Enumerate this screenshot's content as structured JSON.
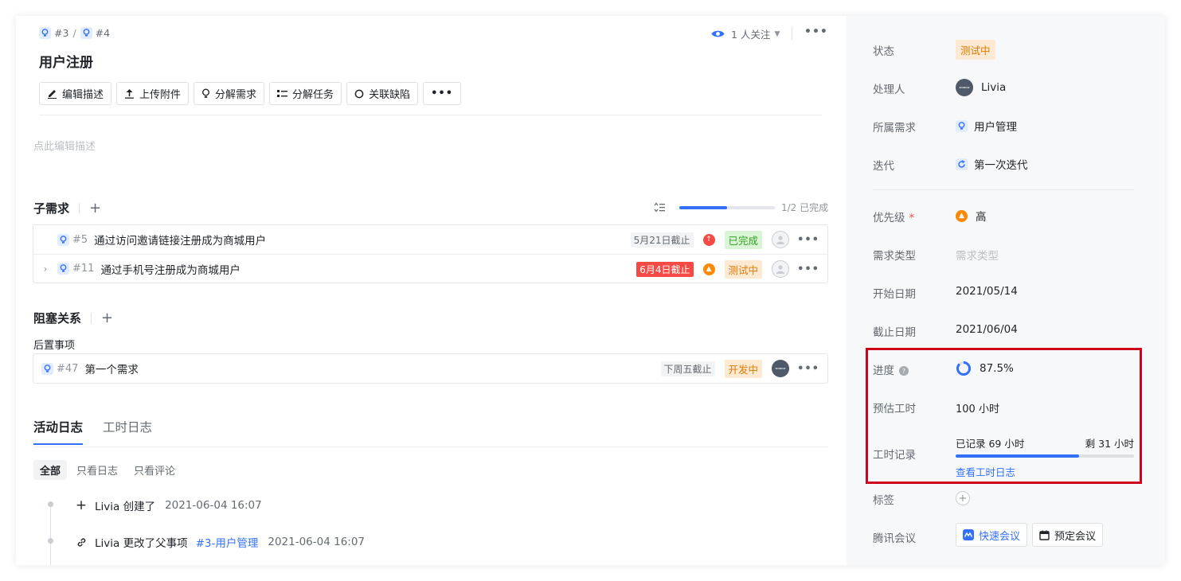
{
  "breadcrumb": {
    "parent": "#3",
    "sep": "/",
    "current": "#4"
  },
  "watch": {
    "label": "1 人关注"
  },
  "title": "用户注册",
  "toolbar": {
    "edit": "编辑描述",
    "upload": "上传附件",
    "split_req": "分解需求",
    "split_task": "分解任务",
    "link_bug": "关联缺陷"
  },
  "description_placeholder": "点此编辑描述",
  "subreq": {
    "title": "子需求",
    "progress_label": "1/2 已完成",
    "progress_fraction": 0.5,
    "items": [
      {
        "num": "#5",
        "name": "通过访问邀请链接注册成为商城用户",
        "due": "5月21日截止",
        "status": "已完成"
      },
      {
        "num": "#11",
        "name": "通过手机号注册成为商城用户",
        "due": "6月4日截止",
        "status": "测试中"
      }
    ]
  },
  "blocking": {
    "title": "阻塞关系",
    "subheading": "后置事项",
    "items": [
      {
        "num": "#47",
        "name": "第一个需求",
        "due": "下周五截止",
        "status": "开发中"
      }
    ]
  },
  "tabs": [
    "活动日志",
    "工时日志"
  ],
  "filters": [
    "全部",
    "只看日志",
    "只看评论"
  ],
  "activity": [
    {
      "text": "Livia 创建了",
      "time": "2021-06-04 16:07"
    },
    {
      "text": "Livia 更改了父事项",
      "link": "#3-用户管理",
      "time": "2021-06-04 16:07"
    }
  ],
  "side": {
    "status": {
      "label": "状态",
      "value": "测试中"
    },
    "assignee": {
      "label": "处理人",
      "value": "Livia"
    },
    "parent_req": {
      "label": "所属需求",
      "value": "用户管理"
    },
    "iteration": {
      "label": "迭代",
      "value": "第一次迭代"
    },
    "priority": {
      "label": "优先级",
      "required": "*",
      "value": "高"
    },
    "req_type": {
      "label": "需求类型",
      "placeholder": "需求类型"
    },
    "start_date": {
      "label": "开始日期",
      "value": "2021/05/14"
    },
    "end_date": {
      "label": "截止日期",
      "value": "2021/06/04"
    },
    "progress": {
      "label": "进度",
      "value": "87.5%",
      "fraction": 0.875
    },
    "estimate": {
      "label": "预估工时",
      "value": "100 小时"
    },
    "hours": {
      "label": "工时记录",
      "logged": "已记录 69 小时",
      "remaining": "剩 31 小时",
      "fraction": 0.69,
      "link": "查看工时日志"
    },
    "tags": {
      "label": "标签"
    },
    "meeting": {
      "label": "腾讯会议",
      "quick": "快速会议",
      "schedule": "预定会议"
    }
  },
  "colors": {
    "accent": "#3370ff",
    "highlight_box": "#d0021b",
    "orange": "#de7802",
    "green": "#2ea121",
    "red": "#f54a45"
  }
}
